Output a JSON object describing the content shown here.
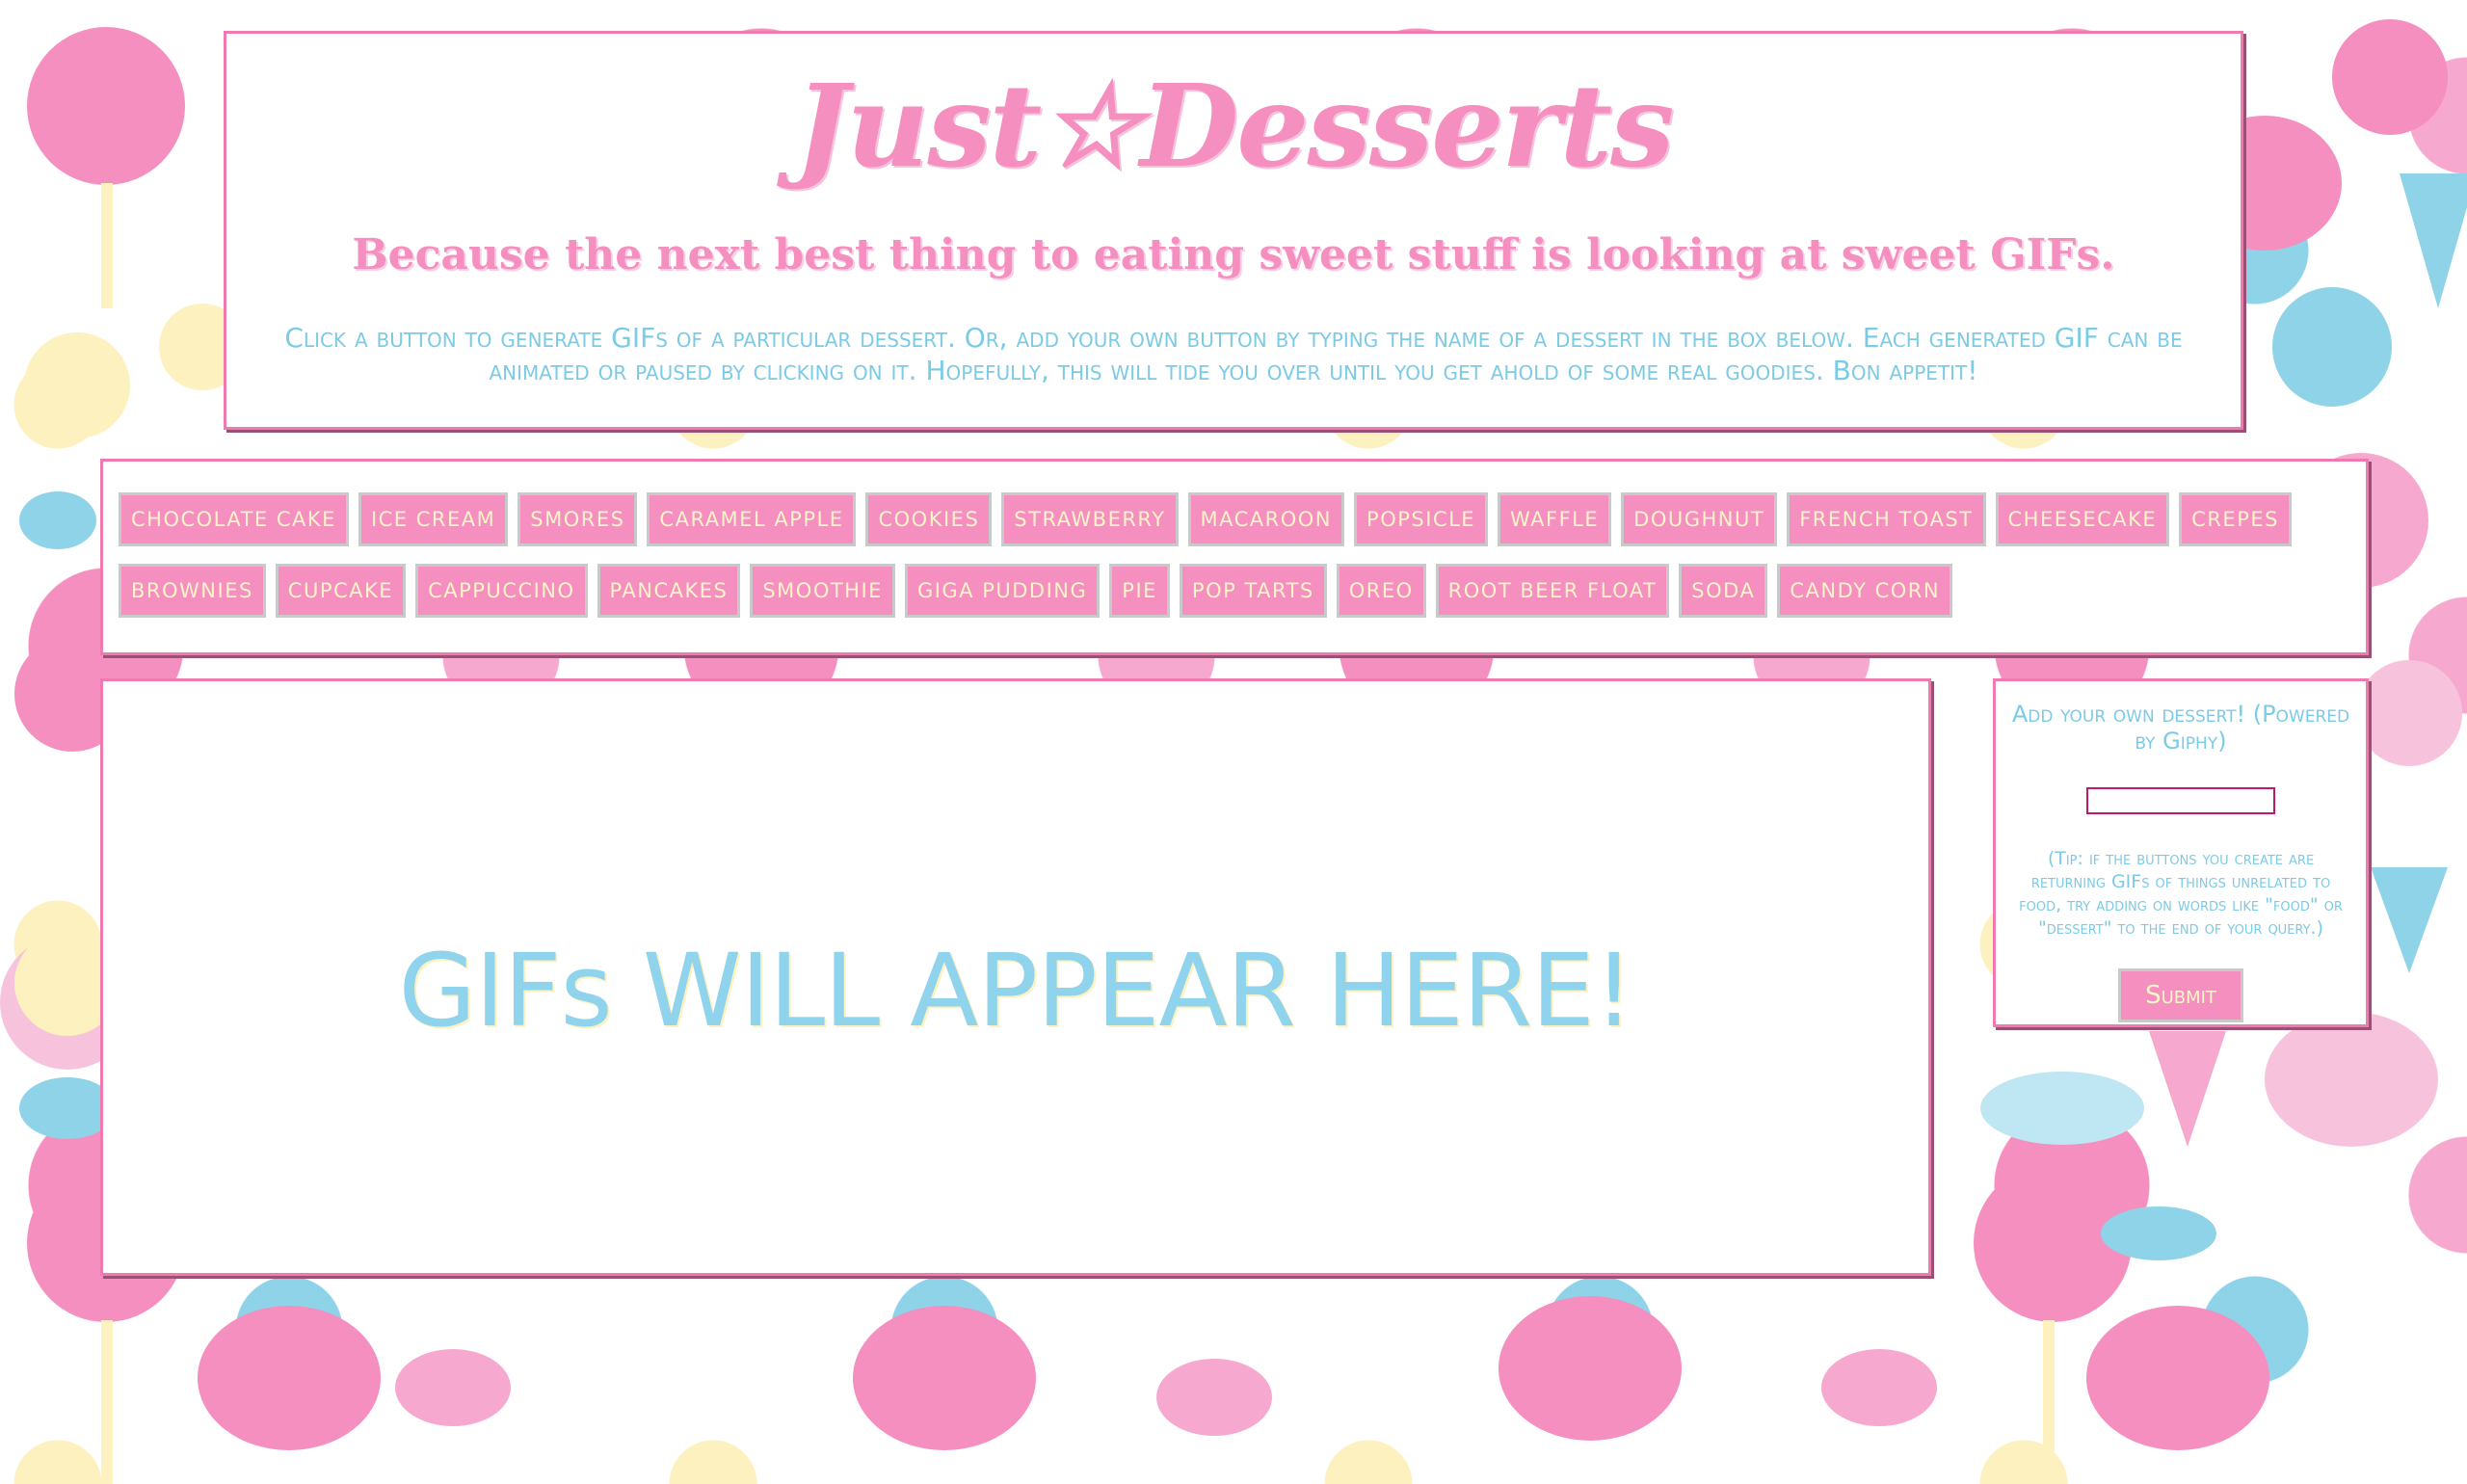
{
  "header": {
    "title": "Just☆Desserts",
    "tagline": "Because the next best thing to eating sweet stuff is looking at sweet GIFs.",
    "instructions": "Click a button to generate GIFs of a particular dessert. Or, add your own button by typing the name of a dessert in the box below. Each generated GIF can be animated or paused by clicking on it. Hopefully, this will tide you over until you get ahold of some real goodies. Bon appetit!"
  },
  "buttons": [
    "chocolate cake",
    "ice cream",
    "smores",
    "caramel apple",
    "cookies",
    "strawberry",
    "macaroon",
    "popsicle",
    "waffle",
    "doughnut",
    "french toast",
    "cheesecake",
    "crepes",
    "brownies",
    "cupcake",
    "cappuccino",
    "pancakes",
    "smoothie",
    "giga pudding",
    "pie",
    "pop tarts",
    "oreo",
    "root beer float",
    "soda",
    "candy corn"
  ],
  "gif_area": {
    "placeholder": "GIFs WILL APPEAR HERE!"
  },
  "form": {
    "title": "Add your own dessert! (Powered by Giphy)",
    "input_value": "",
    "tip": "(Tip: if the buttons you create are returning GIFs of things unrelated to food, try adding on words like \"food\" or \"dessert\" to the end of your query.)",
    "submit_label": "Submit"
  },
  "colors": {
    "pink": "#f48fc0",
    "blue": "#7ccbe6",
    "cream": "#fdf4c8",
    "border": "#f07ab0"
  }
}
